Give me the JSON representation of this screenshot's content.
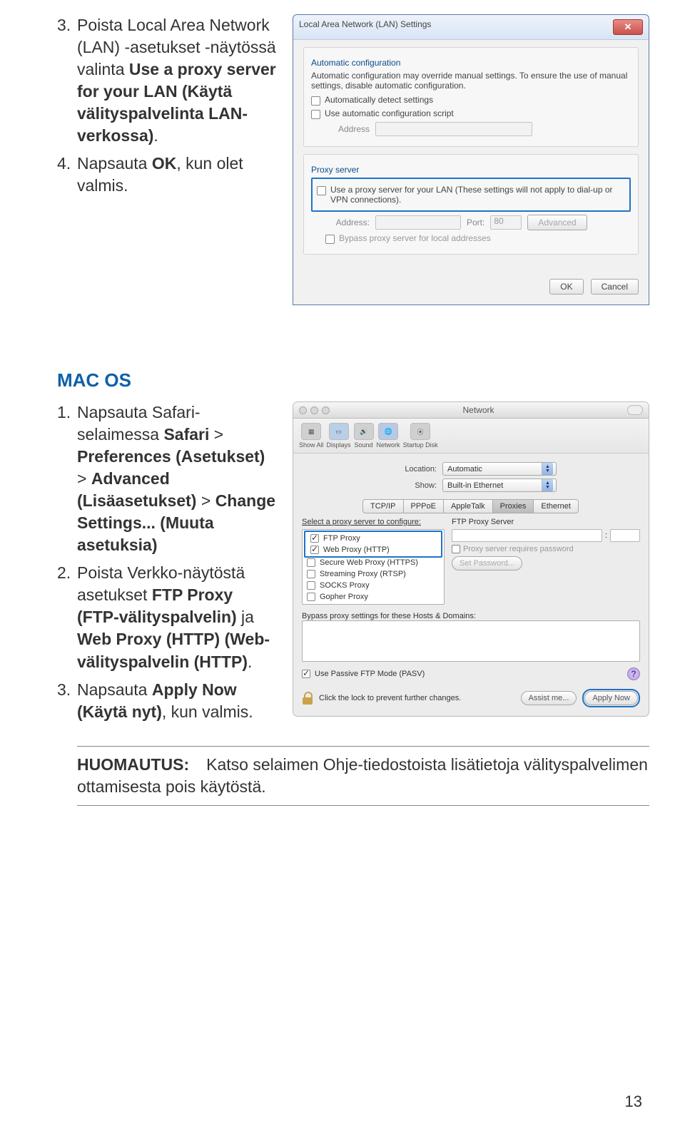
{
  "doc": {
    "sec1": {
      "item3_num": "3.",
      "item3_a": "Poista Local Area Network (LAN) -asetukset -näytössä valinta ",
      "item3_b": "Use a proxy server for your LAN (Käytä välityspalvelinta LAN-verkossa)",
      "item3_c": ".",
      "item4_num": "4.",
      "item4_a": "Napsauta ",
      "item4_b": "OK",
      "item4_c": ", kun olet valmis."
    },
    "mac_heading": "MAC OS",
    "sec2": {
      "i1_num": "1.",
      "i1_a": "Napsauta Safari-selaimessa ",
      "i1_b1": "Safari",
      "i1_b2": " > ",
      "i1_b3": "Preferences (Asetukset)",
      "i1_b4": " > ",
      "i1_b5": "Advanced (Lisäasetukset)",
      "i1_b6": " > ",
      "i1_b7": "Change Settings... (Muuta asetuksia)",
      "i2_num": "2.",
      "i2_a": "Poista Verkko-näytöstä asetukset ",
      "i2_b1": "FTP Proxy (FTP-välityspalvelin)",
      "i2_b2": " ja ",
      "i2_b3": "Web Proxy (HTTP) (Web-välityspalvelin (HTTP)",
      "i2_c": ".",
      "i3_num": "3.",
      "i3_a": "Napsauta ",
      "i3_b": "Apply Now (Käytä nyt)",
      "i3_c": ", kun valmis."
    },
    "note_label": "HUOMAUTUS:",
    "note_text": "Katso selaimen Ohje-tiedostoista lisätietoja välityspalvelimen ottamisesta pois käytöstä.",
    "page": "13"
  },
  "win": {
    "title": "Local Area Network (LAN) Settings",
    "grp1": "Automatic configuration",
    "grp1_desc": "Automatic configuration may override manual settings. To ensure the use of manual settings, disable automatic configuration.",
    "auto_detect": "Automatically detect settings",
    "auto_script": "Use automatic configuration script",
    "address_lbl": "Address",
    "grp2": "Proxy server",
    "use_proxy": "Use a proxy server for your LAN (These settings will not apply to dial-up or VPN connections).",
    "addr2": "Address:",
    "port_lbl": "Port:",
    "port_val": "80",
    "advanced": "Advanced",
    "bypass": "Bypass proxy server for local addresses",
    "ok": "OK",
    "cancel": "Cancel"
  },
  "mac": {
    "title": "Network",
    "toolbar": [
      "Show All",
      "Displays",
      "Sound",
      "Network",
      "Startup Disk"
    ],
    "location_lbl": "Location:",
    "location_val": "Automatic",
    "show_lbl": "Show:",
    "show_val": "Built-in Ethernet",
    "tabs": [
      "TCP/IP",
      "PPPoE",
      "AppleTalk",
      "Proxies",
      "Ethernet"
    ],
    "select_proxy": "Select a proxy server to configure:",
    "proxies": {
      "ftp": "FTP Proxy",
      "web": "Web Proxy (HTTP)",
      "secure": "Secure Web Proxy (HTTPS)",
      "stream": "Streaming Proxy (RTSP)",
      "socks": "SOCKS Proxy",
      "gopher": "Gopher Proxy"
    },
    "ftp_server_lbl": "FTP Proxy Server",
    "requires_pw": "Proxy server requires password",
    "set_pw": "Set Password...",
    "bypass_lbl": "Bypass proxy settings for these Hosts & Domains:",
    "pasv": "Use Passive FTP Mode (PASV)",
    "lock": "Click the lock to prevent further changes.",
    "assist": "Assist me...",
    "apply": "Apply Now"
  }
}
